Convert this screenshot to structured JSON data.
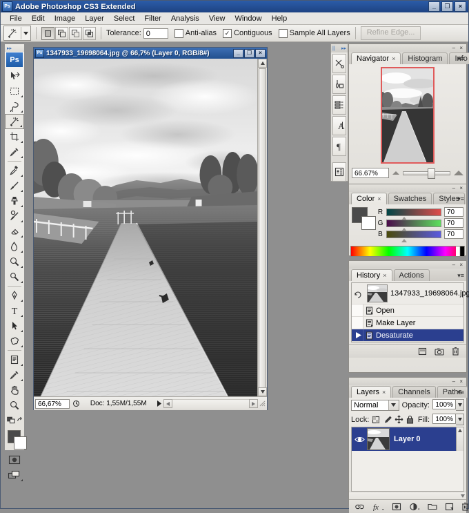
{
  "app": {
    "title": "Adobe Photoshop CS3 Extended",
    "logo": "ps-logo",
    "window_buttons": [
      {
        "name": "minimize",
        "glyph": "_"
      },
      {
        "name": "restore",
        "glyph": "❐"
      },
      {
        "name": "close",
        "glyph": "×"
      }
    ]
  },
  "menubar": {
    "items": [
      {
        "label": "File"
      },
      {
        "label": "Edit"
      },
      {
        "label": "Image"
      },
      {
        "label": "Layer"
      },
      {
        "label": "Select"
      },
      {
        "label": "Filter"
      },
      {
        "label": "Analysis"
      },
      {
        "label": "View"
      },
      {
        "label": "Window"
      },
      {
        "label": "Help"
      }
    ]
  },
  "options_bar": {
    "active_tool": "magic-wand-tool",
    "selection_modes": [
      "new-selection",
      "add-to-selection",
      "subtract-from-selection",
      "intersect-with-selection"
    ],
    "selection_mode_active_index": 0,
    "tolerance_label": "Tolerance:",
    "tolerance_value": "0",
    "antialias_label": "Anti-alias",
    "antialias_checked": false,
    "contiguous_label": "Contiguous",
    "contiguous_checked": true,
    "sample_all_layers_label": "Sample All Layers",
    "sample_all_layers_checked": false,
    "refine_edge_label": "Refine Edge...",
    "refine_edge_enabled": false,
    "check_glyph": "✓"
  },
  "toolbox": {
    "logo": "Ps",
    "selected_tool": "magic-wand-tool",
    "tools": [
      {
        "name": "move-tool"
      },
      {
        "name": "rectangular-marquee-tool"
      },
      {
        "name": "lasso-tool"
      },
      {
        "name": "magic-wand-tool"
      },
      {
        "name": "crop-tool"
      },
      {
        "name": "eyedropper-tool"
      },
      {
        "name": "healing-brush-tool"
      },
      {
        "name": "brush-tool"
      },
      {
        "name": "clone-stamp-tool"
      },
      {
        "name": "history-brush-tool"
      },
      {
        "name": "eraser-tool"
      },
      {
        "name": "gradient-tool"
      },
      {
        "name": "blur-tool"
      },
      {
        "name": "dodge-tool"
      },
      {
        "name": "pen-tool"
      },
      {
        "name": "type-tool"
      },
      {
        "name": "path-selection-tool"
      },
      {
        "name": "custom-shape-tool"
      },
      {
        "name": "notes-tool"
      },
      {
        "name": "eyedropper-color-sampler-tool"
      },
      {
        "name": "hand-tool"
      },
      {
        "name": "zoom-tool"
      }
    ],
    "foreground_color": "#4a4a4a",
    "background_color": "#ffffff",
    "quick_mask": "quick-mask-mode",
    "screen_mode": "screen-mode"
  },
  "right_dock": {
    "icons": [
      {
        "name": "tool-presets-icon"
      },
      {
        "name": "brushes-icon"
      },
      {
        "name": "clone-source-icon"
      },
      {
        "name": "character-icon"
      },
      {
        "name": "paragraph-icon"
      },
      {
        "name": "layer-comps-icon"
      }
    ]
  },
  "document": {
    "title": "1347933_19698064.jpg @ 66,7% (Layer 0, RGB/8#)",
    "window_buttons": [
      {
        "name": "minimize",
        "glyph": "_"
      },
      {
        "name": "restore",
        "glyph": "❐"
      },
      {
        "name": "close",
        "glyph": "×"
      }
    ],
    "zoom_level": "66,67%",
    "doc_info": "Doc: 1,55M/1,55M",
    "image_description": "black-and-white photograph of a wooden pier extending into a lake with hills and clouds"
  },
  "navigator_panel": {
    "tabs": [
      {
        "label": "Navigator",
        "active": true,
        "closable": true
      },
      {
        "label": "Histogram",
        "active": false,
        "closable": false
      },
      {
        "label": "Info",
        "active": false,
        "closable": false
      }
    ],
    "zoom_value": "66.67%",
    "view_box_color": "#e05a5a"
  },
  "color_panel": {
    "tabs": [
      {
        "label": "Color",
        "active": true,
        "closable": true
      },
      {
        "label": "Swatches",
        "active": false,
        "closable": false
      },
      {
        "label": "Styles",
        "active": false,
        "closable": false
      }
    ],
    "channels": [
      {
        "label": "R",
        "value": "70"
      },
      {
        "label": "G",
        "value": "70"
      },
      {
        "label": "B",
        "value": "70"
      }
    ],
    "foreground_color": "#4a4a4a",
    "background_color": "#ffffff"
  },
  "history_panel": {
    "tabs": [
      {
        "label": "History",
        "active": true,
        "closable": true
      },
      {
        "label": "Actions",
        "active": false,
        "closable": false
      }
    ],
    "snapshot": "1347933_19698064.jpg",
    "states": [
      {
        "label": "Open",
        "selected": false
      },
      {
        "label": "Make Layer",
        "selected": false
      },
      {
        "label": "Desaturate",
        "selected": true
      }
    ],
    "footer_buttons": [
      {
        "name": "new-document-from-state-icon"
      },
      {
        "name": "new-snapshot-icon"
      },
      {
        "name": "delete-state-icon"
      }
    ]
  },
  "layers_panel": {
    "tabs": [
      {
        "label": "Layers",
        "active": true,
        "closable": true
      },
      {
        "label": "Channels",
        "active": false,
        "closable": false
      },
      {
        "label": "Paths",
        "active": false,
        "closable": false
      }
    ],
    "blend_mode": "Normal",
    "opacity_label": "Opacity:",
    "opacity_value": "100%",
    "lock_label": "Lock:",
    "lock_buttons": [
      {
        "name": "lock-transparent-pixels-icon"
      },
      {
        "name": "lock-image-pixels-icon"
      },
      {
        "name": "lock-position-icon"
      },
      {
        "name": "lock-all-icon"
      }
    ],
    "fill_label": "Fill:",
    "fill_value": "100%",
    "layers": [
      {
        "name": "Layer 0",
        "visible": true,
        "selected": true
      }
    ],
    "footer_buttons": [
      {
        "name": "link-layers-icon"
      },
      {
        "name": "layer-style-fx-icon"
      },
      {
        "name": "add-layer-mask-icon"
      },
      {
        "name": "new-adjustment-layer-icon"
      },
      {
        "name": "new-group-icon"
      },
      {
        "name": "new-layer-icon"
      },
      {
        "name": "delete-layer-icon"
      }
    ]
  }
}
